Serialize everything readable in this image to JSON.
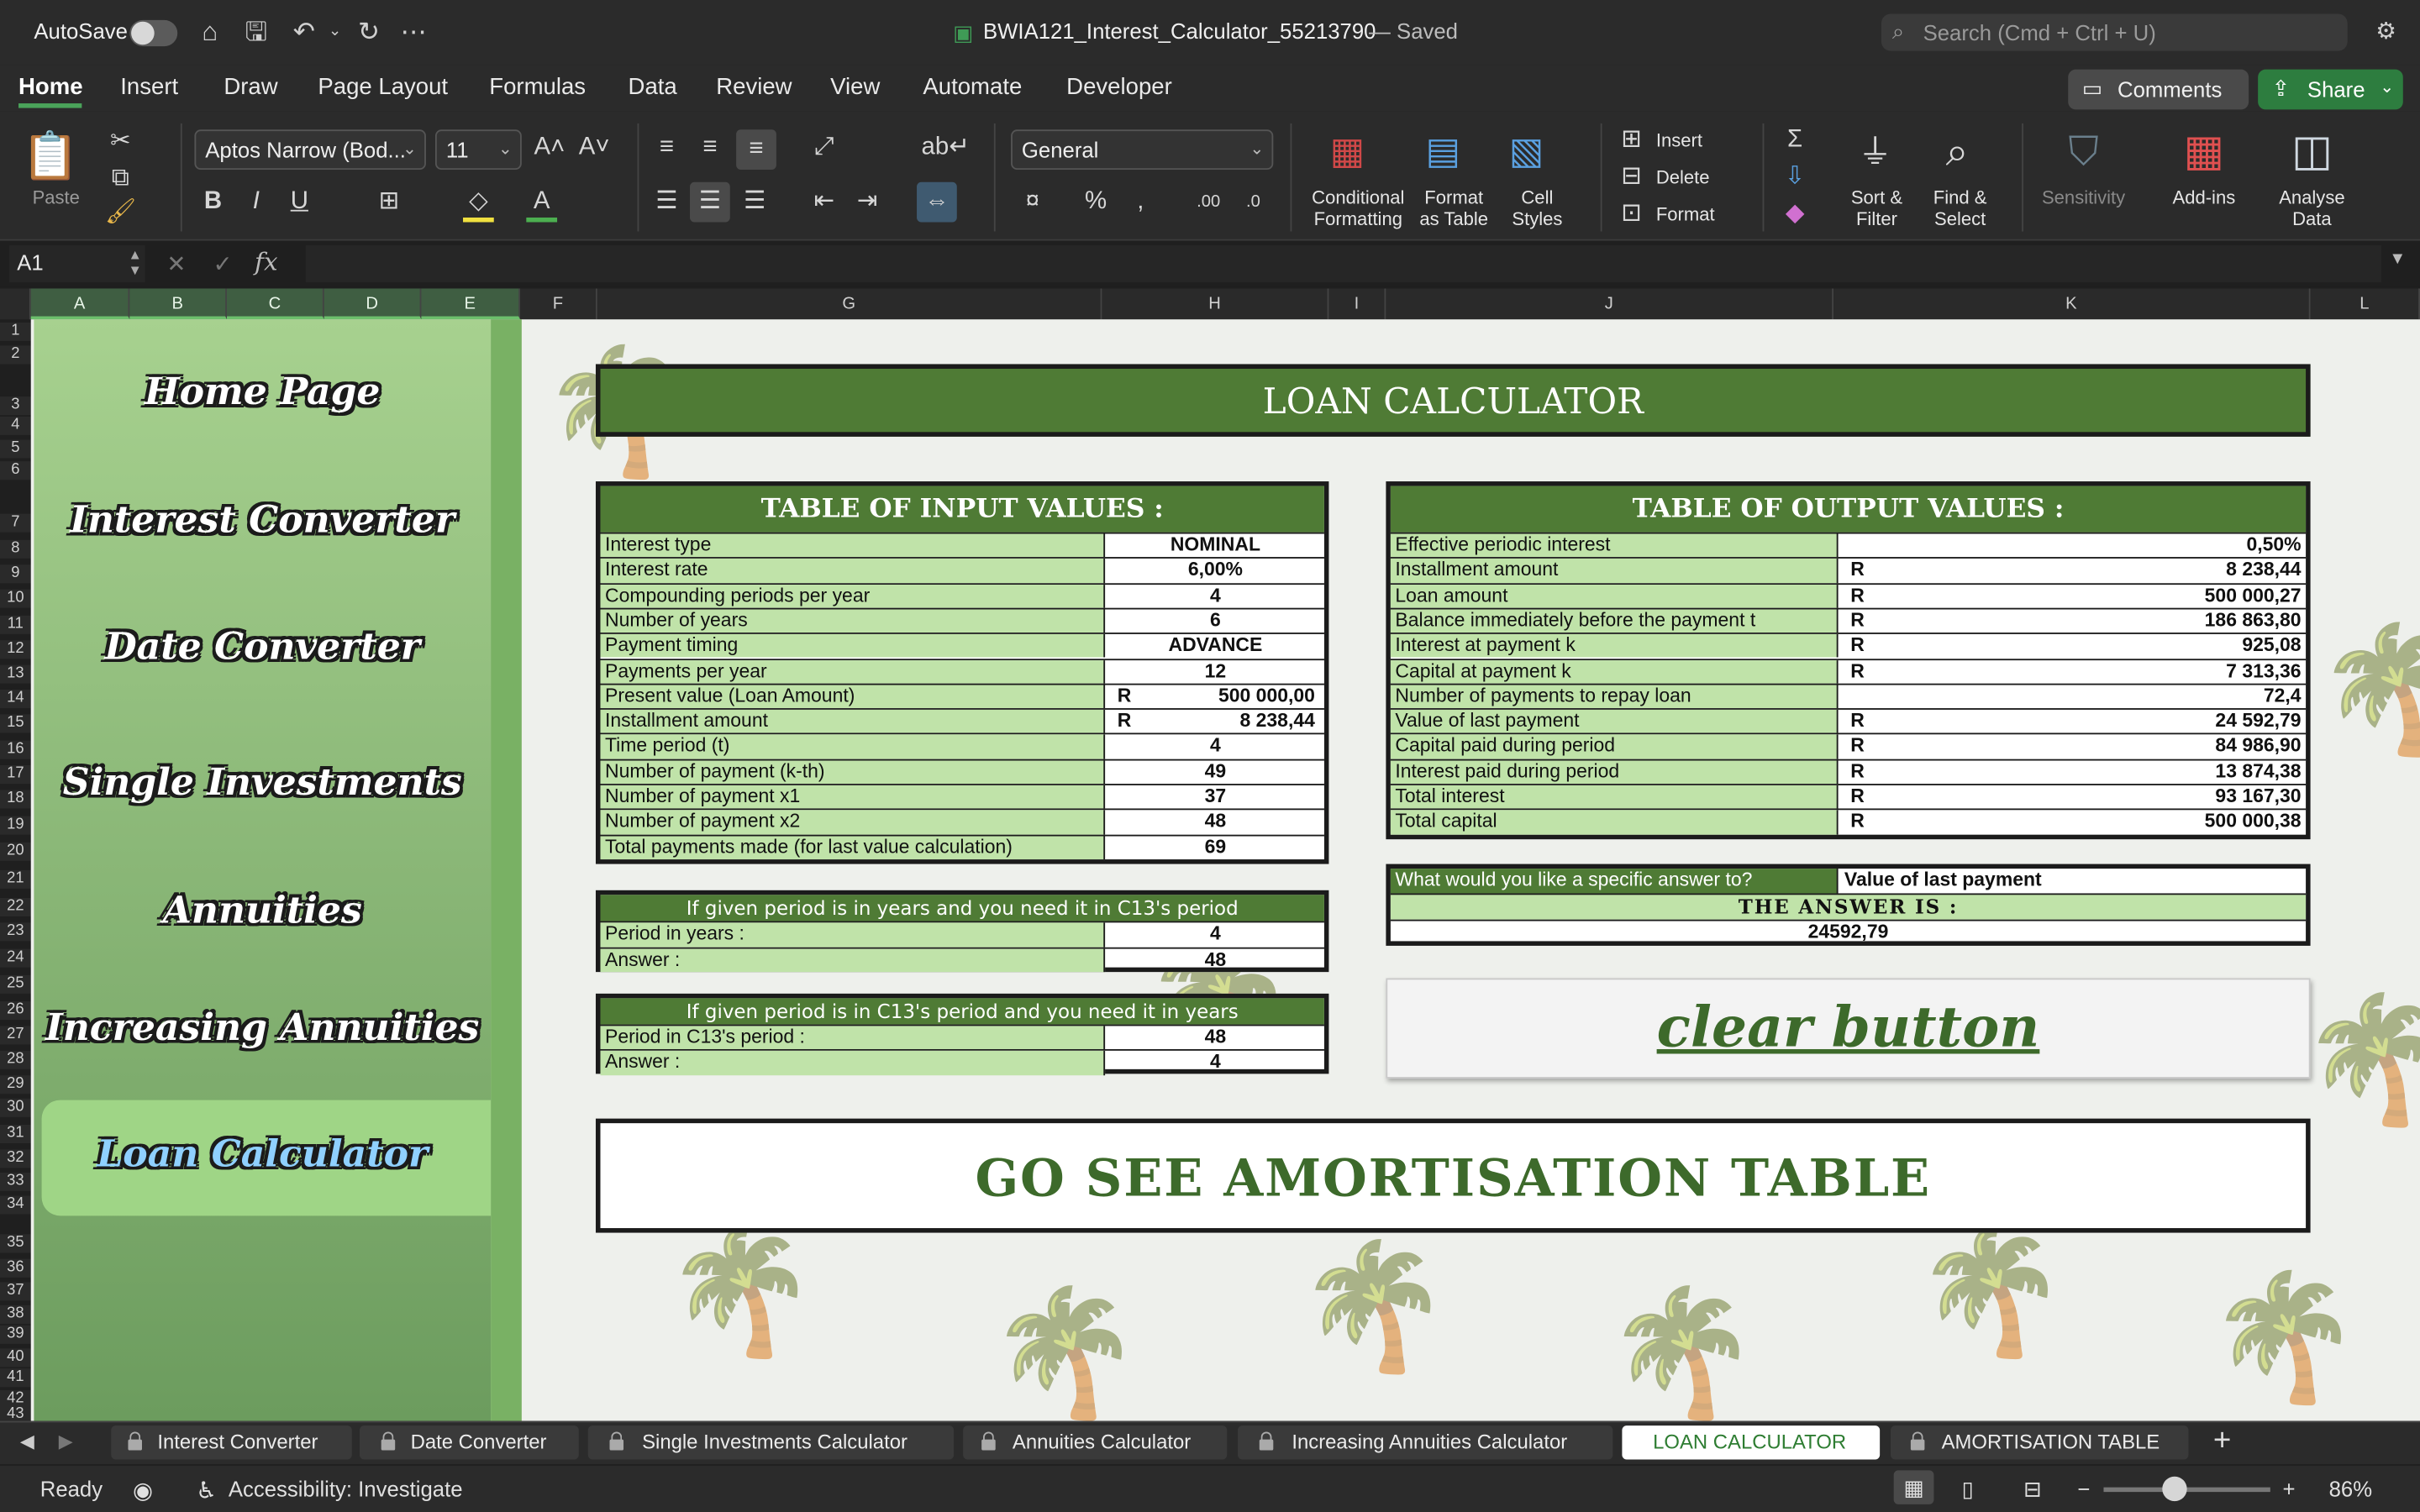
{
  "titlebar": {
    "autosave_label": "AutoSave",
    "file_title": "BWIA121_Interest_Calculator_55213790",
    "saved_status": "— Saved",
    "search_placeholder": "Search (Cmd + Ctrl + U)"
  },
  "menu": {
    "tabs": [
      "Home",
      "Insert",
      "Draw",
      "Page Layout",
      "Formulas",
      "Data",
      "Review",
      "View",
      "Automate",
      "Developer"
    ],
    "active": "Home",
    "comments_label": "Comments",
    "share_label": "Share"
  },
  "ribbon": {
    "paste_label": "Paste",
    "font_name": "Aptos Narrow (Bod...",
    "font_size": "11",
    "number_format": "General",
    "conditional_formatting": [
      "Conditional",
      "Formatting"
    ],
    "format_as_table": [
      "Format",
      "as Table"
    ],
    "cell_styles": [
      "Cell",
      "Styles"
    ],
    "insert_label": "Insert",
    "delete_label": "Delete",
    "format_label": "Format",
    "sort_filter": [
      "Sort &",
      "Filter"
    ],
    "find_select": [
      "Find &",
      "Select"
    ],
    "sensitivity_label": "Sensitivity",
    "addins_label": "Add-ins",
    "analyse_data": [
      "Analyse",
      "Data"
    ]
  },
  "formula_bar": {
    "name_box": "A1",
    "formula": ""
  },
  "columns": [
    "A",
    "B",
    "C",
    "D",
    "E",
    "F",
    "G",
    "H",
    "I",
    "J",
    "K",
    "L"
  ],
  "rows": [
    "1",
    "2",
    "3",
    "4",
    "5",
    "6",
    "7",
    "8",
    "9",
    "10",
    "11",
    "12",
    "13",
    "14",
    "15",
    "16",
    "17",
    "18",
    "19",
    "20",
    "21",
    "22",
    "23",
    "24",
    "25",
    "26",
    "27",
    "28",
    "29",
    "30",
    "31",
    "32",
    "33",
    "34",
    "35",
    "36",
    "37",
    "38",
    "39",
    "40",
    "41",
    "42",
    "43"
  ],
  "nav": {
    "items": [
      "Home Page",
      "Interest Converter",
      "Date Converter",
      "Single Investments",
      "Annuities",
      "Increasing Annuities",
      "Loan Calculator"
    ],
    "active": "Loan Calculator"
  },
  "sheet": {
    "title": "LOAN CALCULATOR",
    "input_table": {
      "header": "TABLE OF INPUT VALUES :",
      "rows": [
        {
          "label": "Interest type",
          "currency": "",
          "value": "NOMINAL"
        },
        {
          "label": "Interest rate",
          "currency": "",
          "value": "6,00%"
        },
        {
          "label": "Compounding periods per year",
          "currency": "",
          "value": "4"
        },
        {
          "label": "Number of years",
          "currency": "",
          "value": "6"
        },
        {
          "label": "Payment timing",
          "currency": "",
          "value": "ADVANCE"
        },
        {
          "label": "Payments per year",
          "currency": "",
          "value": "12"
        },
        {
          "label": "Present value (Loan Amount)",
          "currency": "R",
          "value": "500 000,00"
        },
        {
          "label": "Installment amount",
          "currency": "R",
          "value": "8 238,44"
        },
        {
          "label": "Time period (t)",
          "currency": "",
          "value": "4"
        },
        {
          "label": "Number of payment (k-th)",
          "currency": "",
          "value": "49"
        },
        {
          "label": "Number of payment x1",
          "currency": "",
          "value": "37"
        },
        {
          "label": "Number of payment x2",
          "currency": "",
          "value": "48"
        },
        {
          "label": "Total payments made (for last value calculation)",
          "currency": "",
          "value": "69"
        }
      ]
    },
    "conv1": {
      "header": "If given period is in years and you need it in C13's period",
      "rows": [
        {
          "label": "Period in years :",
          "value": "4"
        },
        {
          "label": "Answer :",
          "value": "48"
        }
      ]
    },
    "conv2": {
      "header": "If given period is in  C13's period and you need it in years",
      "rows": [
        {
          "label": "Period in C13's period :",
          "value": "48"
        },
        {
          "label": "Answer :",
          "value": "4"
        }
      ]
    },
    "output_table": {
      "header": "TABLE OF OUTPUT VALUES :",
      "rows": [
        {
          "label": "Effective periodic interest",
          "currency": "",
          "value": "0,50%"
        },
        {
          "label": "Installment amount",
          "currency": "R",
          "value": "8 238,44"
        },
        {
          "label": "Loan amount",
          "currency": "R",
          "value": "500 000,27"
        },
        {
          "label": "Balance immediately before the payment t",
          "currency": "R",
          "value": "186 863,80"
        },
        {
          "label": "Interest at payment k",
          "currency": "R",
          "value": "925,08"
        },
        {
          "label": "Capital at payment k",
          "currency": "R",
          "value": "7 313,36"
        },
        {
          "label": "Number of payments to repay loan",
          "currency": "",
          "value": "72,4"
        },
        {
          "label": "Value of last payment",
          "currency": "R",
          "value": "24 592,79"
        },
        {
          "label": "Capital paid during period",
          "currency": "R",
          "value": "84 986,90"
        },
        {
          "label": "Interest paid during period",
          "currency": "R",
          "value": "13 874,38"
        },
        {
          "label": "Total interest",
          "currency": "R",
          "value": "93 167,30"
        },
        {
          "label": "Total capital",
          "currency": "R",
          "value": "500 000,38"
        }
      ]
    },
    "answer_box": {
      "question": "What would you like a specific answer to?",
      "selection": "Value of last payment",
      "heading": "THE ANSWER IS :",
      "answer": "24592,79"
    },
    "clear_button": "clear button",
    "amortisation_button": "GO SEE AMORTISATION TABLE"
  },
  "sheet_tabs": {
    "tabs": [
      "Interest Converter",
      "Date Converter",
      "Single Investments Calculator",
      "Annuities Calculator",
      "Increasing Annuities Calculator",
      "LOAN CALCULATOR",
      "AMORTISATION TABLE"
    ],
    "active": "LOAN CALCULATOR"
  },
  "status": {
    "ready": "Ready",
    "accessibility": "Accessibility: Investigate",
    "zoom": "86%",
    "zoom_fraction": 0.43
  },
  "colors": {
    "accent_green": "#4f7b35",
    "label_green": "#c0e3a9",
    "share_green": "#2d7d3f"
  }
}
